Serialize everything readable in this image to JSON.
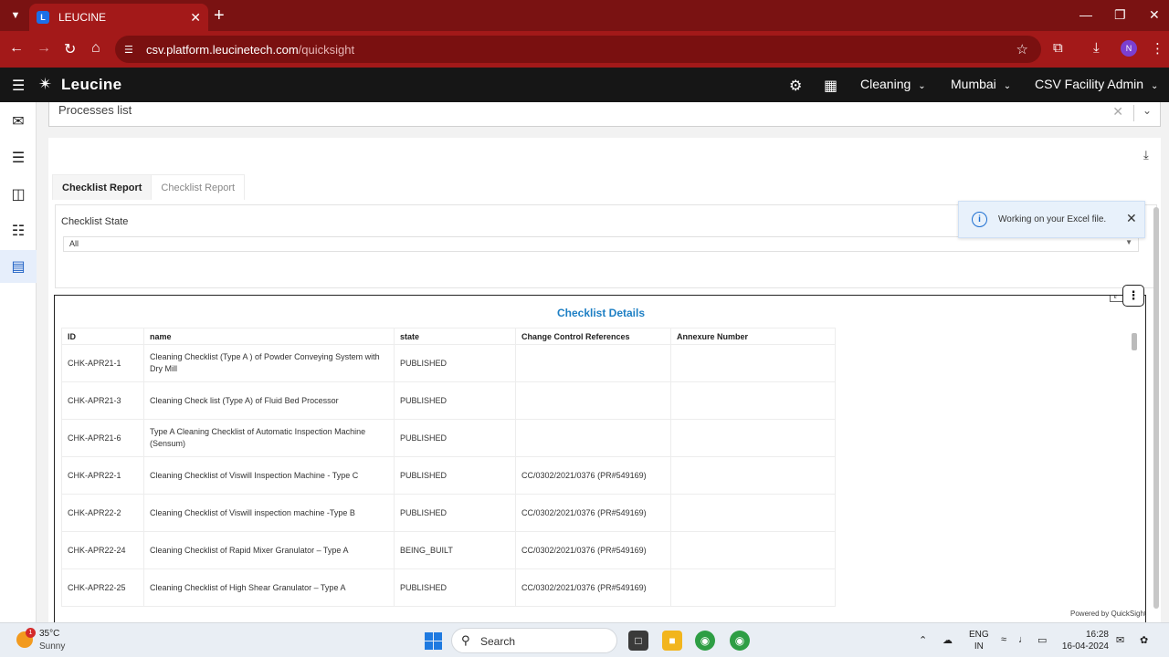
{
  "browser": {
    "tab_title": "LEUCINE",
    "favicon_letter": "L",
    "url_host": "csv.platform.leucinetech.com",
    "url_path": "/quicksight",
    "profile_initial": "N",
    "icons": [
      "chevron-down-icon",
      "close-icon",
      "plus-icon",
      "minimize-icon",
      "restore-icon",
      "back-icon",
      "forward-icon",
      "reload-icon",
      "home-icon",
      "site-info-icon",
      "star-icon",
      "extensions-icon",
      "download-icon",
      "kebab-icon"
    ]
  },
  "app_header": {
    "logo_text": "Leucine",
    "module": "Cleaning",
    "facility": "Mumbai",
    "role": "CSV Facility Admin",
    "icons": [
      "menu-icon",
      "gear-icon",
      "scan-icon"
    ]
  },
  "rail": {
    "items": [
      "inbox-icon",
      "checklist-icon",
      "process-icon",
      "org-tree-icon",
      "report-icon"
    ],
    "active_index": 4
  },
  "process_select": {
    "value": "Processes list"
  },
  "quicksight": {
    "tabs": [
      {
        "label": "Checklist Report",
        "selected": true
      },
      {
        "label": "Checklist Report",
        "selected": false
      }
    ],
    "filter": {
      "label": "Checklist State",
      "value": "All"
    },
    "toast": {
      "message": "Working on your Excel file."
    },
    "visual": {
      "title": "Checklist Details",
      "columns": [
        "ID",
        "name",
        "state",
        "Change Control References",
        "Annexure Number"
      ],
      "rows": [
        [
          "CHK-APR21-1",
          "Cleaning Checklist (Type A ) of Powder Conveying System with Dry Mill",
          "PUBLISHED",
          "",
          ""
        ],
        [
          "CHK-APR21-3",
          "Cleaning Check list (Type A) of Fluid Bed Processor",
          "PUBLISHED",
          "",
          ""
        ],
        [
          "CHK-APR21-6",
          "Type A Cleaning Checklist of Automatic Inspection Machine (Sensum)",
          "PUBLISHED",
          "",
          ""
        ],
        [
          "CHK-APR22-1",
          "Cleaning Checklist of Viswill Inspection Machine - Type C",
          "PUBLISHED",
          "CC/0302/2021/0376 (PR#549169)",
          ""
        ],
        [
          "CHK-APR22-2",
          "Cleaning Checklist of Viswill inspection machine -Type B",
          "PUBLISHED",
          "CC/0302/2021/0376 (PR#549169)",
          ""
        ],
        [
          "CHK-APR22-24",
          "Cleaning Checklist of Rapid Mixer Granulator – Type A",
          "BEING_BUILT",
          "CC/0302/2021/0376 (PR#549169)",
          ""
        ],
        [
          "CHK-APR22-25",
          "Cleaning Checklist of High Shear Granulator – Type A",
          "PUBLISHED",
          "CC/0302/2021/0376 (PR#549169)",
          ""
        ]
      ]
    },
    "footer": "Powered by QuickSight"
  },
  "taskbar": {
    "weather_badge": "1",
    "weather_temp": "35°C",
    "weather_desc": "Sunny",
    "search_label": "Search",
    "lang_top": "ENG",
    "lang_bottom": "IN",
    "time": "16:28",
    "date": "16-04-2024"
  },
  "colors": {
    "tabbar": "#7a1212",
    "addrbar": "#a31919",
    "app_header": "#161616",
    "visual_title": "#1d7fc4",
    "toast_bg": "#e8f1fb"
  }
}
